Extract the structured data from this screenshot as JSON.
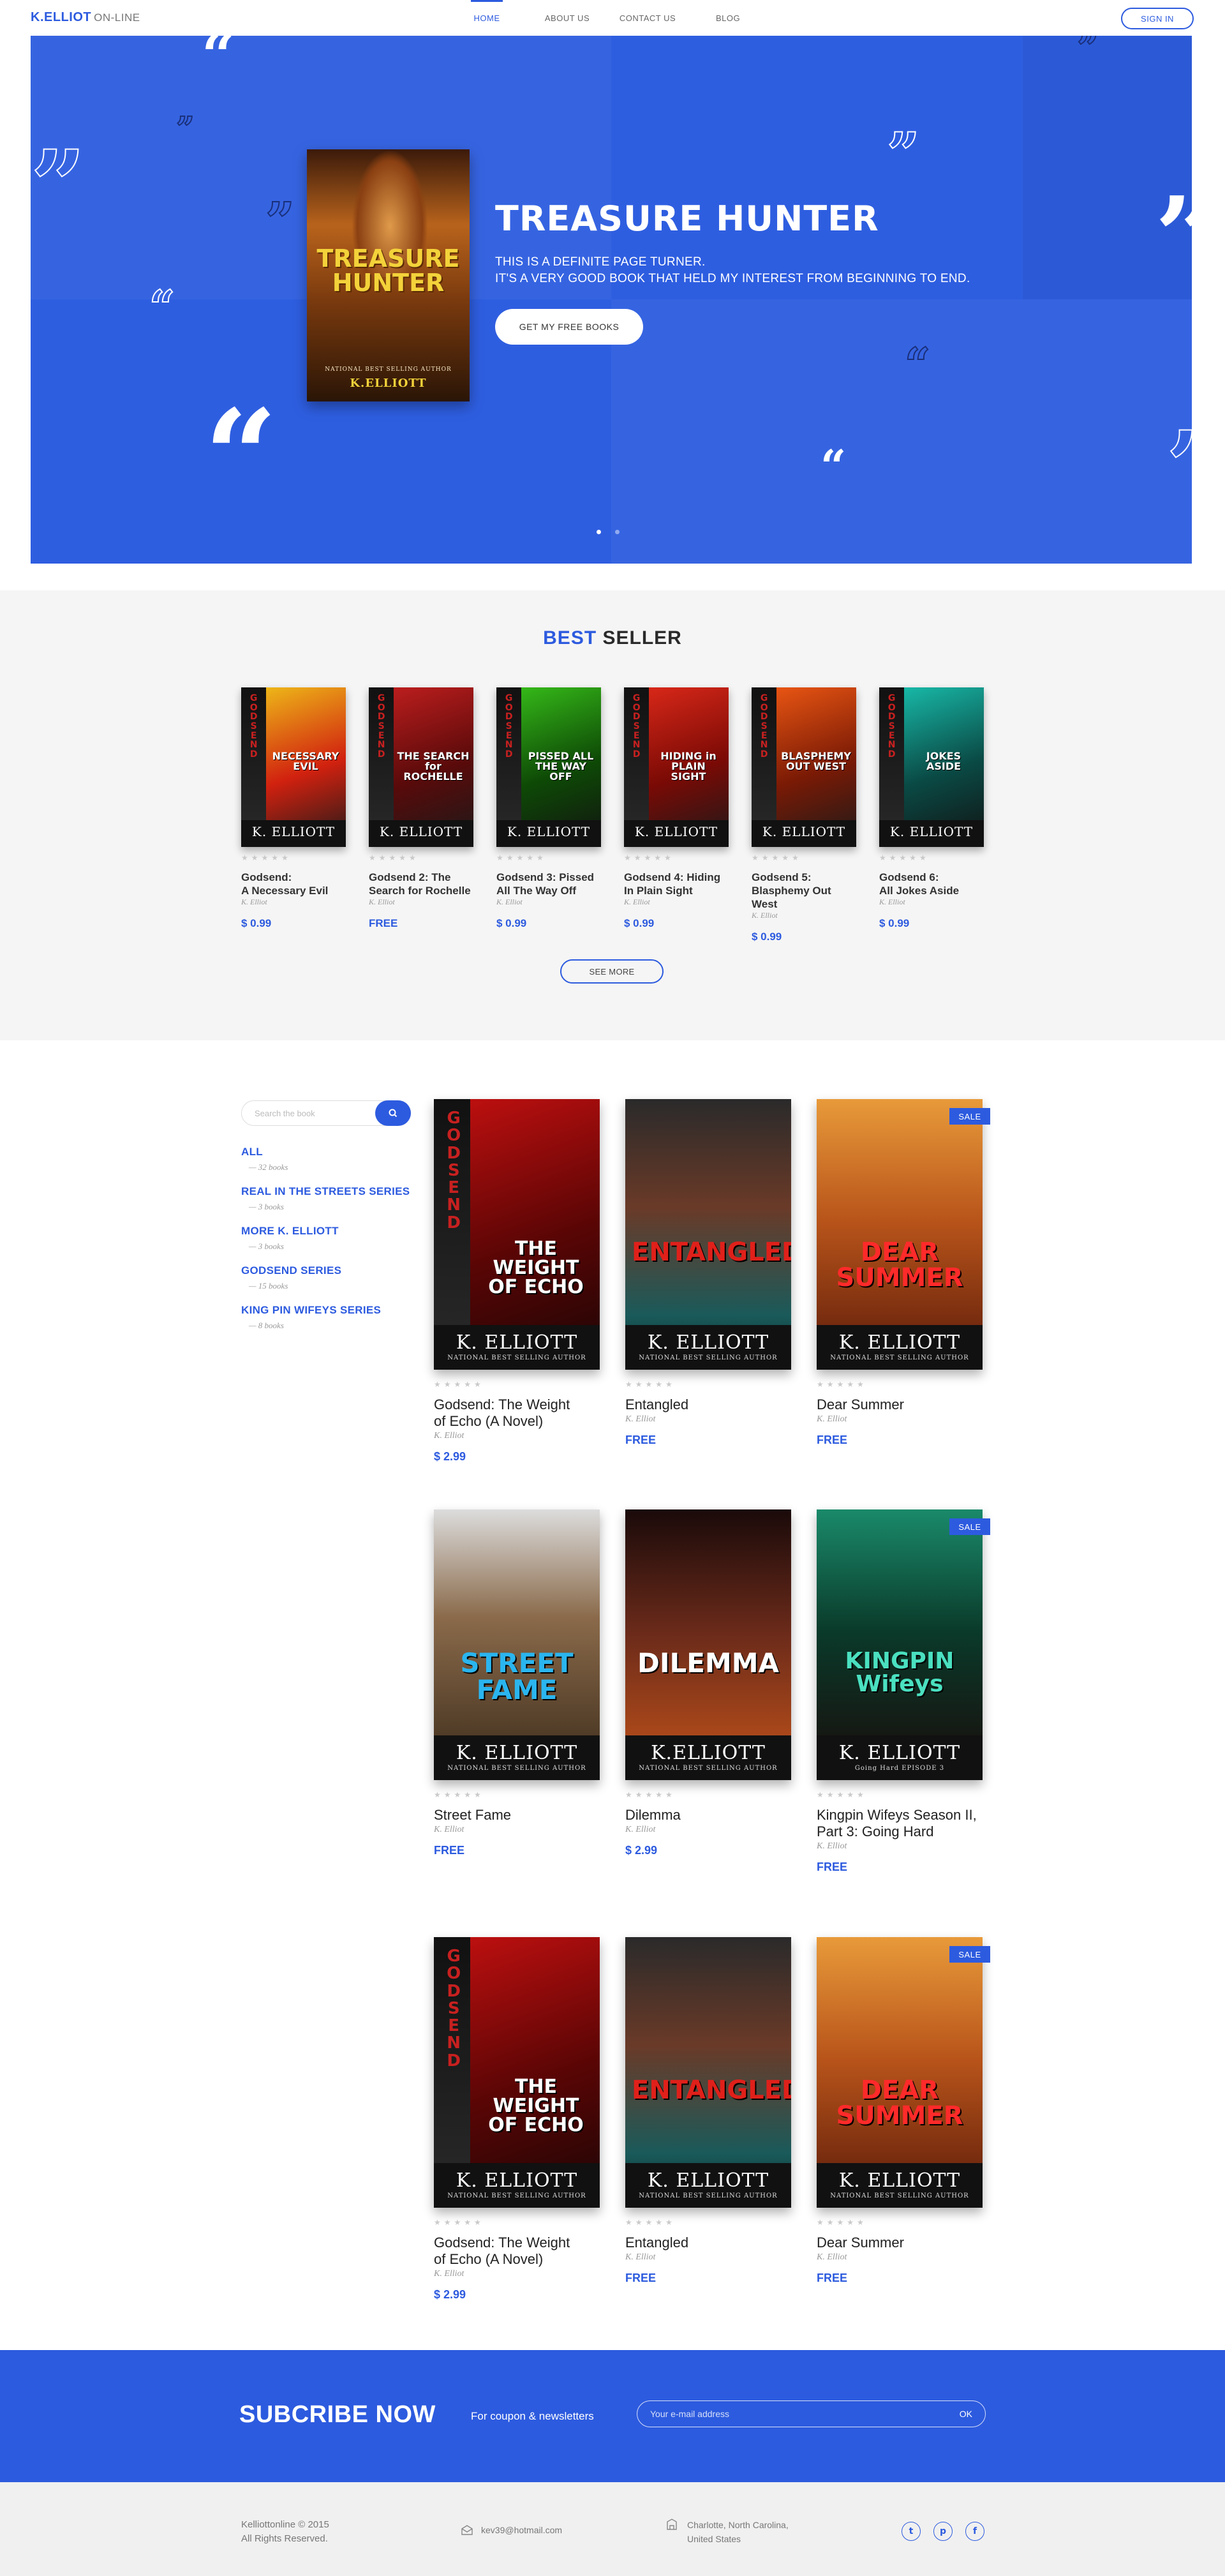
{
  "nav": {
    "logo_brand": "K.ELLIOT",
    "logo_sub": "ON-LINE",
    "links": [
      "HOME",
      "ABOUT US",
      "CONTACT US",
      "BLOG"
    ],
    "active": "HOME",
    "signin_label": "SIGN IN"
  },
  "hero": {
    "title": "TREASURE HUNTER",
    "line1": "THIS IS A DEFINITE PAGE TURNER.",
    "line2": "IT'S A VERY GOOD BOOK THAT HELD MY INTEREST FROM BEGINNING TO END.",
    "cta_label": "GET MY FREE BOOKS",
    "cover": {
      "title_top": "TREASURE",
      "title_bottom": "HUNTER",
      "tagline": "NATIONAL BEST SELLING AUTHOR",
      "author": "K.ELLIOTT"
    },
    "slide_count": 2,
    "active_slide": 1
  },
  "best_seller": {
    "title_blue": "BEST",
    "title_dark": "SELLER",
    "see_more_label": "SEE MORE",
    "books": [
      {
        "line1": "Godsend:",
        "line2": "A Necessary Evil",
        "author": "K. Elliot",
        "price": "$ 0.99",
        "cover_title": "NECESSARY EVIL",
        "cover_author": "K. ELLIOTT",
        "series": "GODSEND"
      },
      {
        "line1": "Godsend 2: The",
        "line2": "Search for Rochelle",
        "author": "K. Elliot",
        "price": "FREE",
        "cover_title": "THE SEARCH for ROCHELLE",
        "cover_author": "K. ELLIOTT",
        "series": "GODSEND"
      },
      {
        "line1": "Godsend 3: Pissed",
        "line2": "All The Way Off",
        "author": "K. Elliot",
        "price": "$ 0.99",
        "cover_title": "PISSED ALL THE WAY OFF",
        "cover_author": "K. ELLIOTT",
        "series": "GODSEND"
      },
      {
        "line1": "Godsend 4: Hiding",
        "line2": "In Plain Sight",
        "author": "K. Elliot",
        "price": "$ 0.99",
        "cover_title": "HIDING in PLAIN SIGHT",
        "cover_author": "K. ELLIOTT",
        "series": "GODSEND"
      },
      {
        "line1": "Godsend 5:",
        "line2": "Blasphemy Out West",
        "author": "K. Elliot",
        "price": "$ 0.99",
        "cover_title": "BLASPHEMY OUT WEST",
        "cover_author": "K. ELLIOTT",
        "series": "GODSEND"
      },
      {
        "line1": "Godsend 6:",
        "line2": "All Jokes Aside",
        "author": "K. Elliot",
        "price": "$ 0.99",
        "cover_title": "JOKES ASIDE",
        "cover_author": "K. ELLIOTT",
        "series": "GODSEND"
      }
    ]
  },
  "sidebar": {
    "search_placeholder": "Search the book",
    "categories": [
      {
        "name": "ALL",
        "count": "— 32 books"
      },
      {
        "name": "REAL IN THE STREETS SERIES",
        "count": "— 3 books"
      },
      {
        "name": "MORE K. ELLIOTT",
        "count": "— 3 books"
      },
      {
        "name": "GODSEND SERIES",
        "count": "— 15 books"
      },
      {
        "name": "KING PIN WIFEYS SERIES",
        "count": "— 8 books"
      }
    ]
  },
  "catalog": {
    "sale_label": "SALE",
    "books": [
      {
        "line1": "Godsend: The Weight",
        "line2": "of Echo (A Novel)",
        "author": "K. Elliot",
        "price": "$ 2.99",
        "sale": false,
        "cover_title": "THE WEIGHT OF ECHO",
        "cover_author": "K. ELLIOTT",
        "tagline": "NATIONAL BEST SELLING AUTHOR",
        "series": "GODSEND"
      },
      {
        "line1": "Entangled",
        "line2": "",
        "author": "K. Elliot",
        "price": "FREE",
        "sale": false,
        "cover_title": "ENTANGLED",
        "cover_author": "K. ELLIOTT",
        "tagline": "NATIONAL BEST SELLING AUTHOR"
      },
      {
        "line1": "Dear Summer",
        "line2": "",
        "author": "K. Elliot",
        "price": "FREE",
        "sale": true,
        "cover_title": "DEAR SUMMER",
        "cover_author": "K. ELLIOTT",
        "tagline": "NATIONAL BEST SELLING AUTHOR"
      },
      {
        "line1": "Street Fame",
        "line2": "",
        "author": "K. Elliot",
        "price": "FREE",
        "sale": false,
        "cover_title": "STREET FAME",
        "cover_author": "K. ELLIOTT",
        "tagline": "NATIONAL BEST SELLING AUTHOR"
      },
      {
        "line1": "Dilemma",
        "line2": "",
        "author": "K. Elliot",
        "price": "$ 2.99",
        "sale": false,
        "cover_title": "DILEMMA",
        "cover_author": "K.ELLIOTT",
        "tagline": "NATIONAL BEST SELLING AUTHOR"
      },
      {
        "line1": "Kingpin Wifeys Season II,",
        "line2": "Part 3: Going Hard",
        "author": "K. Elliot",
        "price": "FREE",
        "sale": true,
        "cover_title": "KINGPIN Wifeys",
        "cover_author": "K. ELLIOTT",
        "tagline": "Going Hard EPISODE 3"
      },
      {
        "line1": "Godsend: The Weight",
        "line2": "of Echo (A Novel)",
        "author": "K. Elliot",
        "price": "$ 2.99",
        "sale": false,
        "cover_title": "THE WEIGHT OF ECHO",
        "cover_author": "K. ELLIOTT",
        "tagline": "NATIONAL BEST SELLING AUTHOR",
        "series": "GODSEND"
      },
      {
        "line1": "Entangled",
        "line2": "",
        "author": "K. Elliot",
        "price": "FREE",
        "sale": false,
        "cover_title": "ENTANGLED",
        "cover_author": "K. ELLIOTT",
        "tagline": "NATIONAL BEST SELLING AUTHOR"
      },
      {
        "line1": "Dear Summer",
        "line2": "",
        "author": "K. Elliot",
        "price": "FREE",
        "sale": true,
        "cover_title": "DEAR SUMMER",
        "cover_author": "K. ELLIOTT",
        "tagline": "NATIONAL BEST SELLING AUTHOR"
      }
    ]
  },
  "subscribe": {
    "title": "SUBCRIBE NOW",
    "text": "For coupon & newsletters",
    "placeholder": "Your e-mail address",
    "ok_label": "OK"
  },
  "footer": {
    "copyright": "Kelliottonline © 2015",
    "rights": "All Rights Reserved.",
    "email": "kev39@hotmail.com",
    "address_line1": "Charlotte, North Carolina,",
    "address_line2": "United States",
    "socials": [
      "twitter-icon",
      "pinterest-icon",
      "facebook-icon"
    ]
  },
  "colors": {
    "accent": "#2d5bdf",
    "hero_bg": "#2e5ee0",
    "best_bg": "#f5f5f5",
    "footer_bg": "#f0f0f0"
  }
}
